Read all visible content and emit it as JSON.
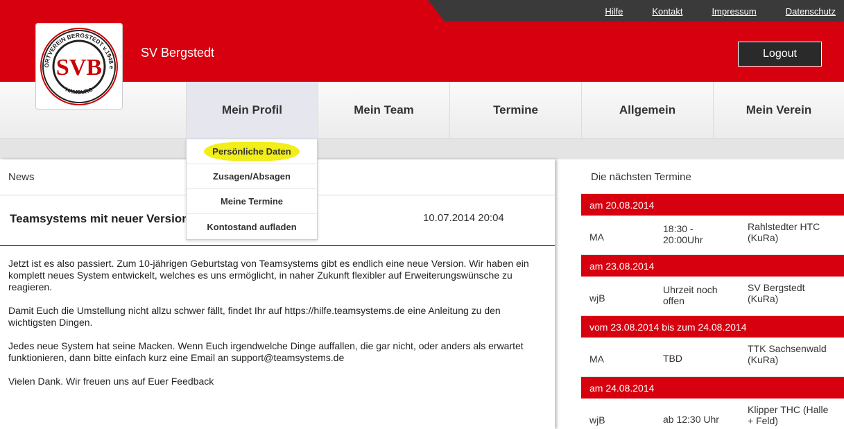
{
  "header": {
    "toplinks": [
      "Hilfe",
      "Kontakt",
      "Impressum",
      "Datenschutz"
    ],
    "club_name": "SV Bergstedt",
    "logout_label": "Logout",
    "logo_top_text": "SPORTVEREIN BERGSTEDT v.1948 e.V.",
    "logo_bottom_text": "HAMBURG",
    "logo_letters": "SVB",
    "brand_color": "#d7000f"
  },
  "nav": {
    "items": [
      "Mein Profil",
      "Mein Team",
      "Termine",
      "Allgemein",
      "Mein Verein"
    ],
    "active": "Mein Profil"
  },
  "dropdown": {
    "items": [
      "Persönliche Daten",
      "Zusagen/Absagen",
      "Meine Termine",
      "Kontostand aufladen"
    ],
    "highlighted": "Persönliche Daten"
  },
  "news": {
    "header": "News",
    "title": "Teamsystems mit neuer Version",
    "date": "10.07.2014 20:04",
    "paragraphs": [
      "Jetzt ist es also passiert. Zum 10-jährigen Geburtstag von Teamsystems gibt es endlich eine neue Version. Wir haben ein komplett neues System entwickelt, welches es uns ermöglicht, in naher Zukunft flexibler auf Erweiterungswünsche zu reagieren.",
      "Damit Euch die Umstellung nicht allzu schwer fällt, findet Ihr auf https://hilfe.teamsystems.de eine Anleitung zu den wichtigsten Dingen.",
      "Jedes neue System hat seine Macken. Wenn Euch irgendwelche Dinge auffallen, die gar nicht, oder anders als erwartet funktionieren, dann bitte einfach kurz eine Email an support@teamsystems.de",
      "Vielen Dank. Wir freuen uns auf Euer Feedback"
    ]
  },
  "termine": {
    "header": "Die nächsten Termine",
    "groups": [
      {
        "date": "am 20.08.2014",
        "team": "MA",
        "time_l1": "18:30 -",
        "time_l2": "20:00Uhr",
        "opp_l1": "Rahlstedter HTC",
        "opp_l2": "(KuRa)"
      },
      {
        "date": "am 23.08.2014",
        "team": "wjB",
        "time_l1": "Uhrzeit noch",
        "time_l2": "offen",
        "opp_l1": "SV Bergstedt",
        "opp_l2": "(KuRa)"
      },
      {
        "date": "vom 23.08.2014 bis zum 24.08.2014",
        "team": "MA",
        "time_l1": "TBD",
        "time_l2": "",
        "opp_l1": "TTK Sachsenwald",
        "opp_l2": "(KuRa)"
      },
      {
        "date": "am 24.08.2014",
        "team": "wjB",
        "time_l1": "ab 12:30 Uhr",
        "time_l2": "",
        "opp_l1": "Klipper THC (Halle",
        "opp_l2": "+ Feld)"
      }
    ]
  }
}
